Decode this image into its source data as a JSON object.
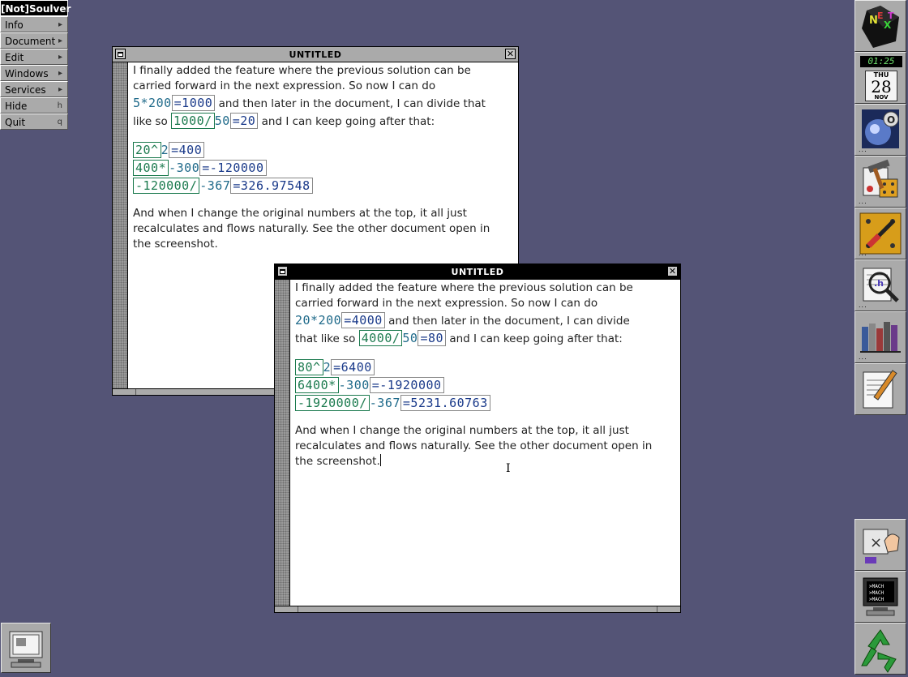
{
  "menu": {
    "title": "[Not]Soulver",
    "items": [
      {
        "label": "Info",
        "key": ""
      },
      {
        "label": "Document",
        "key": ""
      },
      {
        "label": "Edit",
        "key": ""
      },
      {
        "label": "Windows",
        "key": ""
      },
      {
        "label": "Services",
        "key": ""
      },
      {
        "label": "Hide",
        "key": "h"
      },
      {
        "label": "Quit",
        "key": "q"
      }
    ]
  },
  "window_back": {
    "title": "UNTITLED",
    "intro": [
      "I finally added the feature where the previous solution can be",
      "carried forward in the next expression. So now I can do"
    ],
    "l3": {
      "expr": "5*200",
      "res": "=1000",
      "text": " and then later in the document, I can divide that"
    },
    "l4": {
      "pre": "like so ",
      "op": "1000/",
      "num": "50",
      "res": "=20",
      "post": " and I can keep going after that:"
    },
    "c1": {
      "op": "20^",
      "num": "2",
      "res": "=400"
    },
    "c2": {
      "op": "400*",
      "num": "-300",
      "res": "=-120000"
    },
    "c3": {
      "op": "-120000/",
      "num": "-367",
      "res": "=326.97548"
    },
    "outro": [
      "And when I change the original numbers at the top, it all just",
      "recalculates and flows naturally. See the other document open in",
      "the screenshot."
    ]
  },
  "window_front": {
    "title": "UNTITLED",
    "intro": [
      "I finally added the feature where the previous solution can be",
      "carried forward in the next expression. So now I can do"
    ],
    "l3": {
      "expr": "20*200",
      "res": "=4000",
      "text": " and then later in the document, I can divide"
    },
    "l4": {
      "pre": "that like so ",
      "op": "4000/",
      "num": "50",
      "res": "=80",
      "post": " and I can keep going after that:"
    },
    "c1": {
      "op": "80^",
      "num": "2",
      "res": "=6400"
    },
    "c2": {
      "op": "6400*",
      "num": "-300",
      "res": "=-1920000"
    },
    "c3": {
      "op": "-1920000/",
      "num": "-367",
      "res": "=5231.60763"
    },
    "outro": [
      "And when I change the original numbers at the top, it all just",
      "recalculates and flows naturally. See the other document open in",
      "the screenshot."
    ]
  },
  "dock": {
    "clock_time": "01:25",
    "cal_dow": "THU",
    "cal_day": "28",
    "cal_month": "NOV",
    "icons": [
      "next-logo-icon",
      "clock-icon",
      "globe-icon",
      "interface-builder-icon",
      "preferences-icon",
      "header-viewer-icon",
      "books-icon",
      "edit-icon",
      "workspace-icon",
      "terminal-icon",
      "recycler-icon"
    ]
  }
}
